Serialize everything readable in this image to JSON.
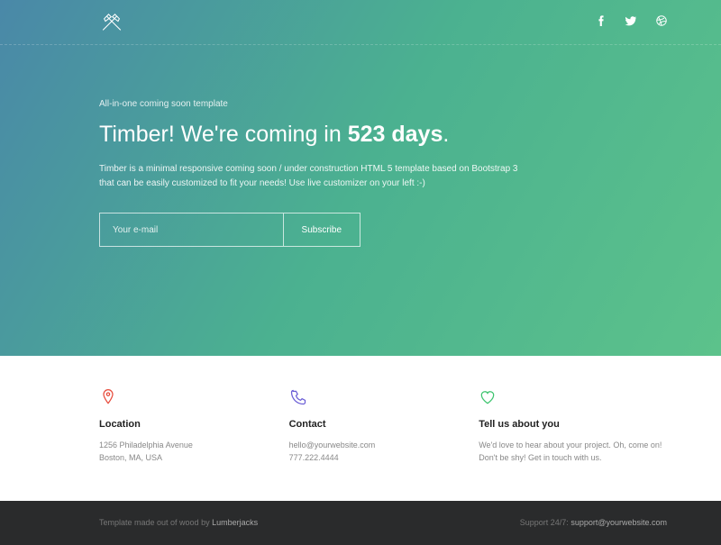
{
  "hero": {
    "tagline": "All-in-one coming soon template",
    "headline_bold1": "Timber!",
    "headline_mid": " We're coming in ",
    "headline_bold2": "523 days",
    "headline_end": ".",
    "description": "Timber is a minimal responsive coming soon / under construction HTML 5 template based on Bootstrap 3 that can be easily customized to fit your needs! Use live customizer on your left :-)",
    "email_placeholder": "Your e-mail",
    "subscribe_label": "Subscribe"
  },
  "info": {
    "location": {
      "title": "Location",
      "line1": "1256 Philadelphia Avenue",
      "line2": "Boston, MA, USA"
    },
    "contact": {
      "title": "Contact",
      "line1": "hello@yourwebsite.com",
      "line2": "777.222.4444"
    },
    "about": {
      "title": "Tell us about you",
      "text": "We'd love to hear about your project. Oh, come on! Don't be shy! Get in touch with us."
    }
  },
  "footer": {
    "left_prefix": "Template made out of wood by ",
    "left_strong": "Lumberjacks",
    "right_prefix": "Support 24/7: ",
    "right_strong": "support@yourwebsite.com"
  }
}
